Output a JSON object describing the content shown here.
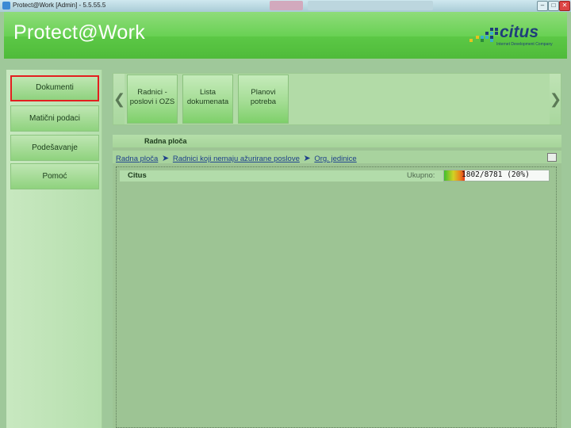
{
  "window": {
    "title": "Protect@Work [Admin] - 5.5.55.5",
    "controls": {
      "minimize": "–",
      "maximize": "□",
      "close": "✕"
    }
  },
  "header": {
    "app_name": "Protect@Work",
    "logo": {
      "word": "citus",
      "tagline": "Internet Development Company"
    }
  },
  "nav": {
    "items": [
      {
        "label": "Dokumenti",
        "active": true
      },
      {
        "label": "Matični podaci"
      },
      {
        "label": "Podešavanje"
      },
      {
        "label": "Pomoć"
      }
    ]
  },
  "ribbon": {
    "tiles": [
      {
        "label": "Radnici - poslovi i OZS"
      },
      {
        "label": "Lista dokumenata"
      },
      {
        "label": "Planovi potreba"
      }
    ],
    "left_arrow": "❮",
    "right_arrow": "❯"
  },
  "content": {
    "panel_title": "Radna ploča",
    "breadcrumb": [
      "Radna ploča",
      "Radnici koji nemaju ažurirane poslove",
      "Org. jedinice"
    ],
    "breadcrumb_sep": "➤",
    "tree": {
      "row_name": "Citus",
      "total_label": "Ukupno:",
      "progress_text": "1802/8781 (20%)",
      "progress_fraction": 0.2
    }
  },
  "colors": {
    "header_green": "#63cf4e",
    "active_border": "#e31f1f",
    "link_blue": "#1d3f8a"
  }
}
